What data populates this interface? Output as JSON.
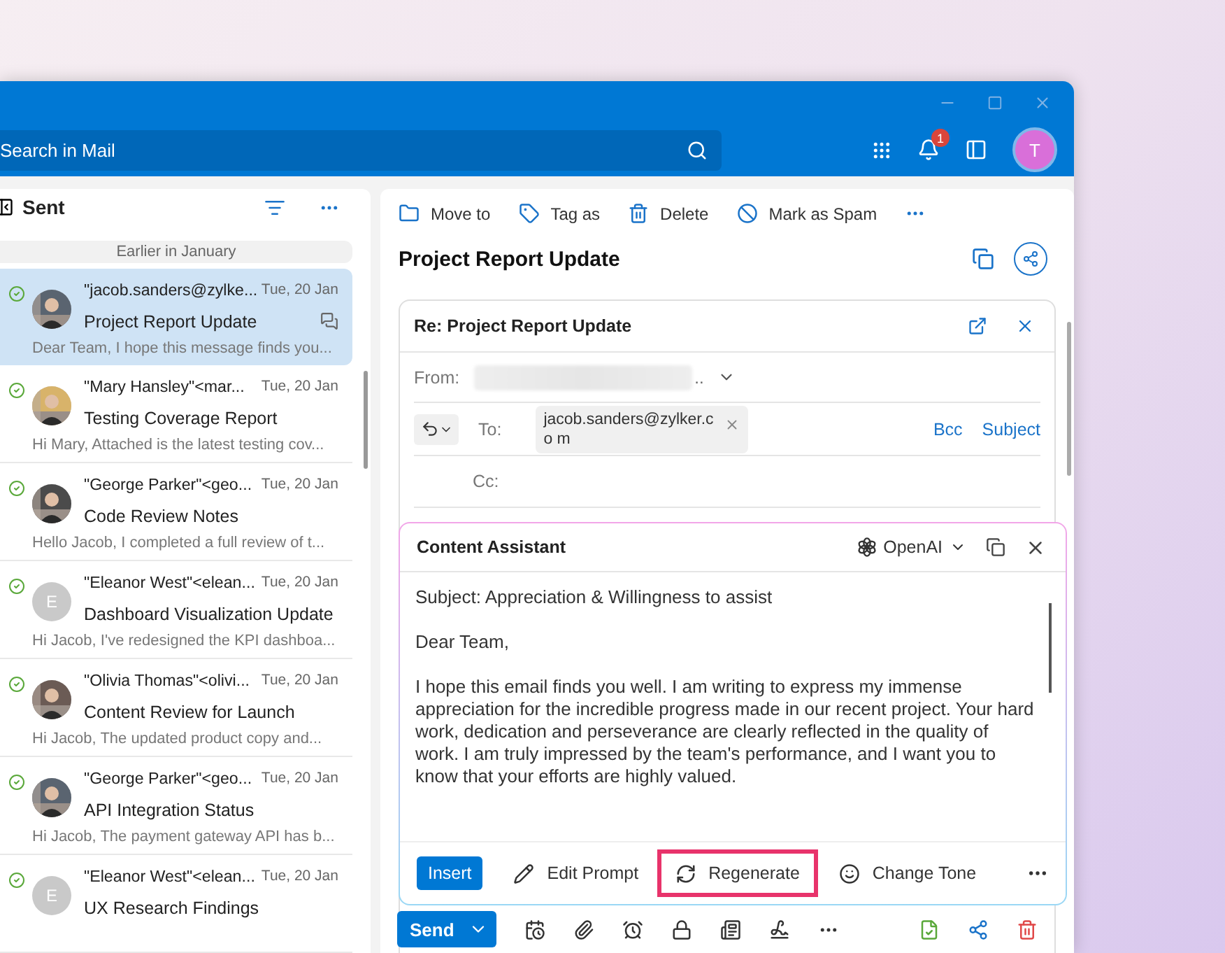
{
  "top_bar": {
    "search": {
      "placeholder": "Search in Mail"
    },
    "notifications": "1",
    "avatar": "T"
  },
  "folder": {
    "title": "Sent",
    "group": "Earlier in January"
  },
  "messages": [
    {
      "sender": "\"jacob.sanders@zylke...",
      "date": "Tue, 20 Jan",
      "subject": "Project Report Update",
      "preview": "Dear Team, I hope this message finds you...",
      "selected": true,
      "sent": true,
      "thread": true
    },
    {
      "sender": "\"Mary Hansley\"<mar...",
      "date": "Tue, 20 Jan",
      "subject": "Testing Coverage Report",
      "preview": "Hi Mary, Attached is the latest testing cov...",
      "selected": false,
      "sent": true,
      "thread": false
    },
    {
      "sender": "\"George Parker\"<geo...",
      "date": "Tue, 20 Jan",
      "subject": "Code Review Notes",
      "preview": "Hello Jacob, I completed a full review of t...",
      "selected": false,
      "sent": true,
      "thread": false
    },
    {
      "sender": "\"Eleanor West\"<elean...",
      "date": "Tue, 20 Jan",
      "subject": "Dashboard Visualization Update",
      "preview": "Hi Jacob, I've redesigned the KPI dashboa...",
      "selected": false,
      "sent": true,
      "thread": false,
      "avatar": {
        "kind": "initial",
        "initial": "E"
      }
    },
    {
      "sender": "\"Olivia Thomas\"<olivi...",
      "date": "Tue, 20 Jan",
      "subject": "Content Review for Launch",
      "preview": "Hi Jacob, The updated product copy and...",
      "selected": false,
      "sent": true,
      "thread": false
    },
    {
      "sender": "\"George Parker\"<geo...",
      "date": "Tue, 20 Jan",
      "subject": "API Integration Status",
      "preview": "Hi Jacob, The payment gateway API has b...",
      "selected": false,
      "sent": true,
      "thread": false
    },
    {
      "sender": "\"Eleanor West\"<elean...",
      "date": "Tue, 20 Jan",
      "subject": "UX Research Findings",
      "selected": false,
      "sent": true,
      "thread": false,
      "avatar": {
        "kind": "initial",
        "initial": "E"
      }
    }
  ],
  "toolbar": [
    {
      "kind": "folder",
      "label": "Move to"
    },
    {
      "kind": "tag",
      "label": "Tag as"
    },
    {
      "kind": "trash",
      "label": "Delete"
    },
    {
      "kind": "spam",
      "label": "Mark as Spam"
    },
    {
      "kind": "more"
    }
  ],
  "mail_title": "Project Report Update",
  "compose": {
    "title": "Re: Project Report Update",
    "from_label": "From:",
    "from_value": "..",
    "to_label": "To:",
    "recipient": "jacob.sanders@zylker.co m",
    "bcc": "Bcc",
    "subject_link": "Subject",
    "cc_label": "Cc:"
  },
  "assistant": {
    "title": "Content Assistant",
    "provider": "OpenAI",
    "paragraphs": [
      "Subject: Appreciation & Willingness to assist",
      "Dear Team,",
      "I hope this email finds you well. I am writing to express my immense appreciation for the incredible progress made in our recent project. Your hard work, dedication and perseverance are clearly reflected in the quality of work. I am truly impressed by the team's performance, and I want you to know that your efforts are highly valued."
    ],
    "actions": [
      {
        "kind": "primary",
        "label": "Insert",
        "highlighted": false
      },
      {
        "kind": "edit",
        "label": "Edit Prompt",
        "highlighted": false
      },
      {
        "kind": "regenerate",
        "label": "Regenerate",
        "highlighted": true
      },
      {
        "kind": "tone",
        "label": "Change Tone",
        "highlighted": false
      },
      {
        "kind": "more",
        "highlighted": false
      }
    ]
  },
  "send": {
    "label": "Send"
  }
}
